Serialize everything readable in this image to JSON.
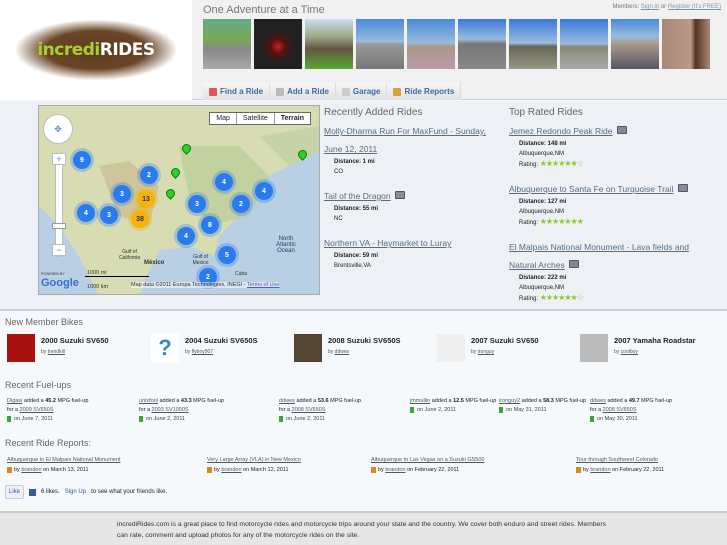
{
  "header": {
    "logo_text_green": "incredi",
    "logo_text_white": "RIDES",
    "tagline": "One Adventure at a Time",
    "members_label": "Members:",
    "sign_in": "Sign in",
    "or": "or",
    "register": "Register (It's FREE)"
  },
  "nav": [
    {
      "label": "Find a Ride",
      "icon": "map-pin-icon"
    },
    {
      "label": "Add a Ride",
      "icon": "add-icon"
    },
    {
      "label": "Garage",
      "icon": "wrench-icon"
    },
    {
      "label": "Ride Reports",
      "icon": "notebook-icon"
    }
  ],
  "map": {
    "types": [
      "Map",
      "Satellite",
      "Terrain"
    ],
    "selected": "Terrain",
    "clusters": [
      "9",
      "2",
      "3",
      "13",
      "4",
      "3",
      "38",
      "3",
      "4",
      "2",
      "4",
      "8",
      "4",
      "5",
      "2",
      "4"
    ],
    "labels": {
      "gulf_ca": "Gulf of California",
      "mexico": "México",
      "gulf_mx": "Gulf of Mexico",
      "atlantic": "North Atlantic Ocean",
      "cuba": "Cuba"
    },
    "scale_mi": "1000 mi",
    "scale_km": "1000 km",
    "powered": "POWERED BY",
    "google": "Google",
    "attribution": "Map data ©2011 Europa Technologies, INEGI -",
    "terms": "Terms of Use"
  },
  "recent": {
    "title": "Recently Added Rides",
    "rides": [
      {
        "name": "Molly-Dharma Run For MaxFund - Sunday, June 12, 2011",
        "distance": "Distance: 1 mi",
        "location": "CO",
        "photo": false
      },
      {
        "name": "Tail of the Dragon",
        "distance": "Distance: 55 mi",
        "location": "NC",
        "photo": true
      },
      {
        "name": "Northern VA - Haymarket to Luray",
        "distance": "Distance: 59 mi",
        "location": "Brentsville,VA",
        "photo": false
      }
    ]
  },
  "top": {
    "title": "Top Rated Rides",
    "rating_label": "Rating:",
    "rides": [
      {
        "name": "Jemez Redondo Peak Ride",
        "distance": "Distance: 148 mi",
        "location": "Albuquerque,NM",
        "rating": 6,
        "max": 7
      },
      {
        "name": "Albuquerque to Santa Fe on Turquoise Trail",
        "distance": "Distance: 127 mi",
        "location": "Albuquerque,NM",
        "rating": 7,
        "max": 7
      },
      {
        "name": "El Malpais National Monument - Lava fields and Natural Arches",
        "distance": "Distance: 222 mi",
        "location": "Albuquerque,NM",
        "rating": 6,
        "max": 7
      }
    ]
  },
  "bikes": {
    "title": "New Member Bikes",
    "items": [
      {
        "name": "2000 Suzuki SV650",
        "by": "by",
        "user": "trendkill"
      },
      {
        "name": "2004 Suzuki SV650S",
        "by": "by",
        "user": "flyboy907"
      },
      {
        "name": "2008 Suzuki SV650S",
        "by": "by",
        "user": "ddwes"
      },
      {
        "name": "2007 Suzuki SV650",
        "by": "by",
        "user": "ironguy"
      },
      {
        "name": "2007 Yamaha Roadstar",
        "by": "by",
        "user": "coolboy"
      }
    ]
  },
  "fuel": {
    "title": "Recent Fuel-ups",
    "items": [
      {
        "user": "Digasi",
        "pre": "added a",
        "mpg": "45.2",
        "post": "MPG fuel-up for a",
        "bike": "2009 SV650S",
        "date": "on June 7, 2011"
      },
      {
        "user": "unixfool",
        "pre": "added a",
        "mpg": "43.3",
        "post": "MPG fuel-up for a",
        "bike": "2003 SV1000S",
        "date": "on June 2, 2011"
      },
      {
        "user": "ddwes",
        "pre": "added a",
        "mpg": "53.6",
        "post": "MPG fuel-up for a",
        "bike": "2008 SV650S",
        "date": "on June 2, 2011"
      },
      {
        "user": "jmmullin",
        "pre": "added a",
        "mpg": "12.5",
        "post": "MPG fuel-up",
        "bike": "",
        "date": "on June 2, 2011"
      },
      {
        "user": "ironguy2",
        "pre": "added a",
        "mpg": "58.3",
        "post": "MPG fuel-up",
        "bike": "",
        "date": "on May 31, 2011"
      },
      {
        "user": "ddwes",
        "pre": "added a",
        "mpg": "49.7",
        "post": "MPG fuel-up for a",
        "bike": "2008 SV650S",
        "date": "on May 30, 2011"
      }
    ]
  },
  "reports": {
    "title": "Recent Ride Reports:",
    "items": [
      {
        "title": "Albuquerque to El Malpais National Monument",
        "by": "by",
        "user": "brandon",
        "date": "on March 13, 2011"
      },
      {
        "title": "Very Large Array (VLA) in New Mexico",
        "by": "by",
        "user": "brandon",
        "date": "on March 12, 2011"
      },
      {
        "title": "Albuquerque to Las Vegas on a Suzuki GS500",
        "by": "by",
        "user": "brandon",
        "date": "on February 22, 2011"
      },
      {
        "title": "Tour through Southwest Colorado",
        "by": "by",
        "user": "brandon",
        "date": "on February 22, 2011"
      }
    ]
  },
  "facebook": {
    "like": "Like",
    "count": "6 likes.",
    "signup": "Sign Up",
    "rest": "to see what your friends like."
  },
  "footer": {
    "text": "incrediRides.com is a great place to find motorcycle rides and motorcycle trips around your state and the country. We cover both enduro and street rides. Members can rate, comment and upload photos for any of the motorcycle rides on the site."
  }
}
